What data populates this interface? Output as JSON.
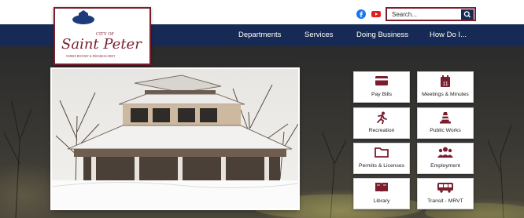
{
  "logo": {
    "line1": "CITY OF",
    "line2": "Saint Peter",
    "tagline": "WHERE HISTORY & PROGRESS MEET"
  },
  "social": {
    "facebook": "facebook-icon",
    "youtube": "youtube-icon"
  },
  "search": {
    "placeholder": "Search..."
  },
  "nav": {
    "items": [
      {
        "label": "Departments"
      },
      {
        "label": "Services"
      },
      {
        "label": "Doing Business"
      },
      {
        "label": "How Do I..."
      }
    ]
  },
  "tiles": [
    {
      "label": "Pay Bills",
      "icon": "credit-card-icon"
    },
    {
      "label": "Meetings & Minutes",
      "icon": "calendar-icon"
    },
    {
      "label": "Recreation",
      "icon": "runner-icon"
    },
    {
      "label": "Public Works",
      "icon": "traffic-cone-icon"
    },
    {
      "label": "Permits & Licenses",
      "icon": "folder-icon"
    },
    {
      "label": "Employment",
      "icon": "people-icon"
    },
    {
      "label": "Library",
      "icon": "book-icon"
    },
    {
      "label": "Transit - MRVT",
      "icon": "bus-icon"
    }
  ],
  "colors": {
    "navy": "#162a55",
    "maroon": "#7a1e2e",
    "tile_icon": "#7a1e2e"
  }
}
